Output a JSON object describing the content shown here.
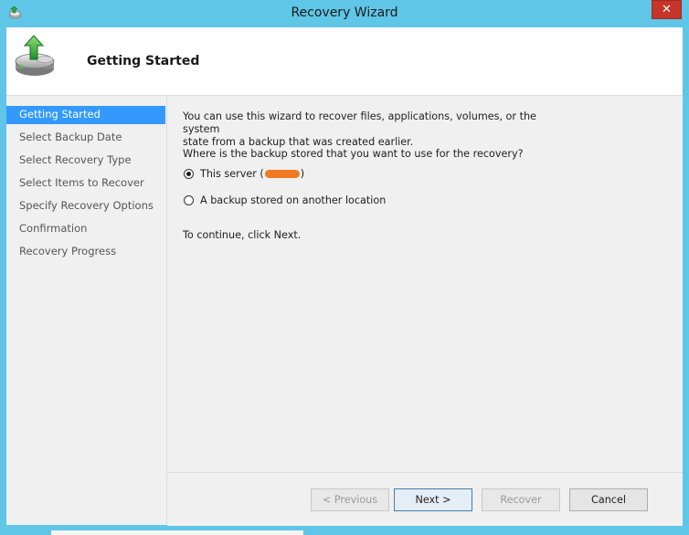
{
  "window": {
    "title": "Recovery Wizard",
    "close_glyph": "✕",
    "app_icon": "recovery-app-icon",
    "frame_color": "#5fc6e8",
    "close_color": "#c7342a"
  },
  "header": {
    "title": "Getting Started",
    "icon": "backup-drive-restore-icon"
  },
  "nav": {
    "items": [
      {
        "label": "Getting Started",
        "selected": true
      },
      {
        "label": "Select Backup Date",
        "selected": false
      },
      {
        "label": "Select Recovery Type",
        "selected": false
      },
      {
        "label": "Select Items to Recover",
        "selected": false
      },
      {
        "label": "Specify Recovery Options",
        "selected": false
      },
      {
        "label": "Confirmation",
        "selected": false
      },
      {
        "label": "Recovery Progress",
        "selected": false
      }
    ],
    "selected_color": "#3399ff"
  },
  "content": {
    "intro_line1": "You can use this wizard to recover files, applications, volumes, or the system",
    "intro_line2": "state from a backup that was created earlier.",
    "question": "Where is the backup stored that you want to use for the recovery?",
    "options": [
      {
        "label_prefix": "This server (",
        "label_suffix": ")",
        "checked": true
      },
      {
        "label": "A backup stored on another location",
        "checked": false
      }
    ],
    "continue_text": "To continue, click Next."
  },
  "buttons": {
    "previous": "< Previous",
    "next": "Next >",
    "recover": "Recover",
    "cancel": "Cancel"
  }
}
